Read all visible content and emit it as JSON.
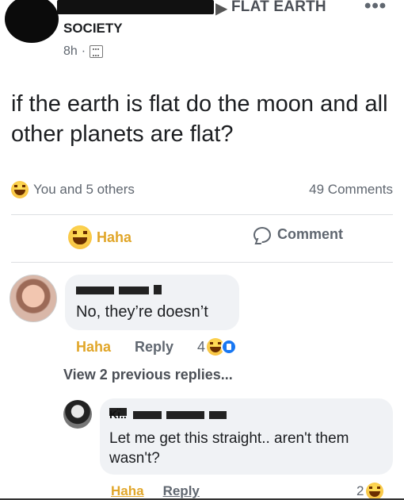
{
  "post": {
    "group_name": "FLAT EARTH",
    "author_name": "SOCIETY",
    "timestamp": "8h",
    "separator": "·",
    "text": "if the earth is flat do the moon and all other planets are flat?",
    "reactions_summary": "You and 5 others",
    "comments_count": "49 Comments",
    "action_haha": "Haha",
    "action_comment": "Comment",
    "more_glyph": "•••",
    "arrow_glyph": "▶"
  },
  "comments": [
    {
      "text": "No, they’re doesn’t",
      "haha_label": "Haha",
      "reply_label": "Reply",
      "reaction_count": "4"
    }
  ],
  "view_replies": "View 2 previous replies...",
  "reply": {
    "name_initial": "Kı̈..",
    "text": "Let me get this straight.. aren't them wasn't?",
    "haha_label": "Haha",
    "reply_label": "Reply",
    "reaction_count": "2"
  },
  "colors": {
    "haha_gold": "#e1a629",
    "bubble_bg": "#f0f2f5",
    "meta_gray": "#606770",
    "like_blue": "#1877f2"
  },
  "icons": {
    "privacy": "group-globe-icon",
    "reaction": "haha-emoji-icon",
    "comment": "comment-bubble-icon",
    "like": "like-thumb-icon"
  }
}
